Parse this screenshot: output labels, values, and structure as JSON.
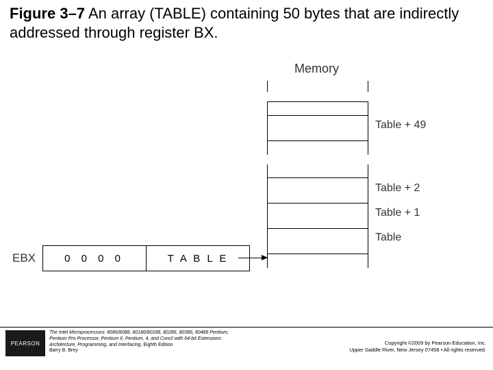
{
  "title": {
    "figure_label": "Figure 3–7",
    "caption": "  An array (TABLE) containing 50 bytes that are indirectly addressed through register BX."
  },
  "diagram": {
    "memory_label": "Memory",
    "cells": {
      "top_block_label": "Table + 49",
      "row3_label": "Table + 2",
      "row2_label": "Table + 1",
      "row1_label": "Table"
    },
    "register": {
      "name": "EBX",
      "high_word": "0 0 0 0",
      "low_word": "T A B L E"
    }
  },
  "footer": {
    "logo_text": "PEARSON",
    "book_line1_italic": "The Intel Microprocessors: 8086/8088, 80186/80188, 80286, 80386, 80486 Pentium,",
    "book_line2_italic": "Pentium Pro Processor, Pentium II, Pentium, 4, and Core2 with 64-bit Extensions",
    "book_line3_italic": "Architecture, Programming, and Interfacing",
    "book_line3_plain": ", Eighth Edition",
    "book_line4": "Barry B. Brey",
    "copyright_line1": "Copyright ©2009 by Pearson Education, Inc.",
    "copyright_line2": "Upper Saddle River, New Jersey 07458 • All rights reserved."
  }
}
